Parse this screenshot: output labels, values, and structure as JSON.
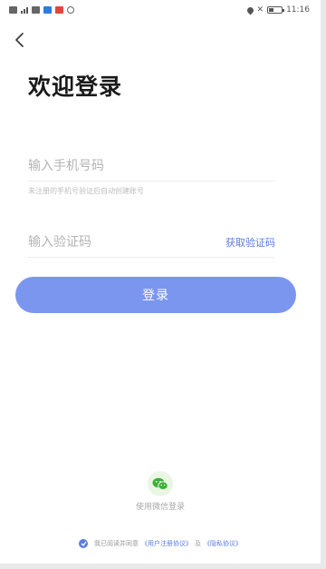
{
  "status_bar": {
    "time": "11:16",
    "left_icons": [
      "sim-icon",
      "signal-icon",
      "app-notification-icon",
      "app-notification-icon",
      "app-notification-icon",
      "app-notification-icon"
    ],
    "right_icons": [
      "location-icon",
      "no-sim-icon",
      "battery-icon"
    ]
  },
  "header": {
    "back_icon": "chevron-left-icon",
    "title": "欢迎登录"
  },
  "phone_field": {
    "placeholder": "输入手机号码",
    "value": ""
  },
  "phone_hint": "未注册的手机号验证后自动创建账号",
  "code_field": {
    "placeholder": "输入验证码",
    "value": "",
    "get_code_label": "获取验证码"
  },
  "login_button": {
    "label": "登录"
  },
  "wechat_login": {
    "icon": "wechat-icon",
    "label": "使用微信登录"
  },
  "agreement": {
    "checked": true,
    "prefix": "我已阅读并同意",
    "user_agreement": "《用户注册协议》",
    "conjunction": "及",
    "privacy_policy": "《隐私协议》"
  },
  "colors": {
    "accent": "#5b7de0",
    "button": "#7b96ee",
    "wechat": "#3fae35"
  }
}
